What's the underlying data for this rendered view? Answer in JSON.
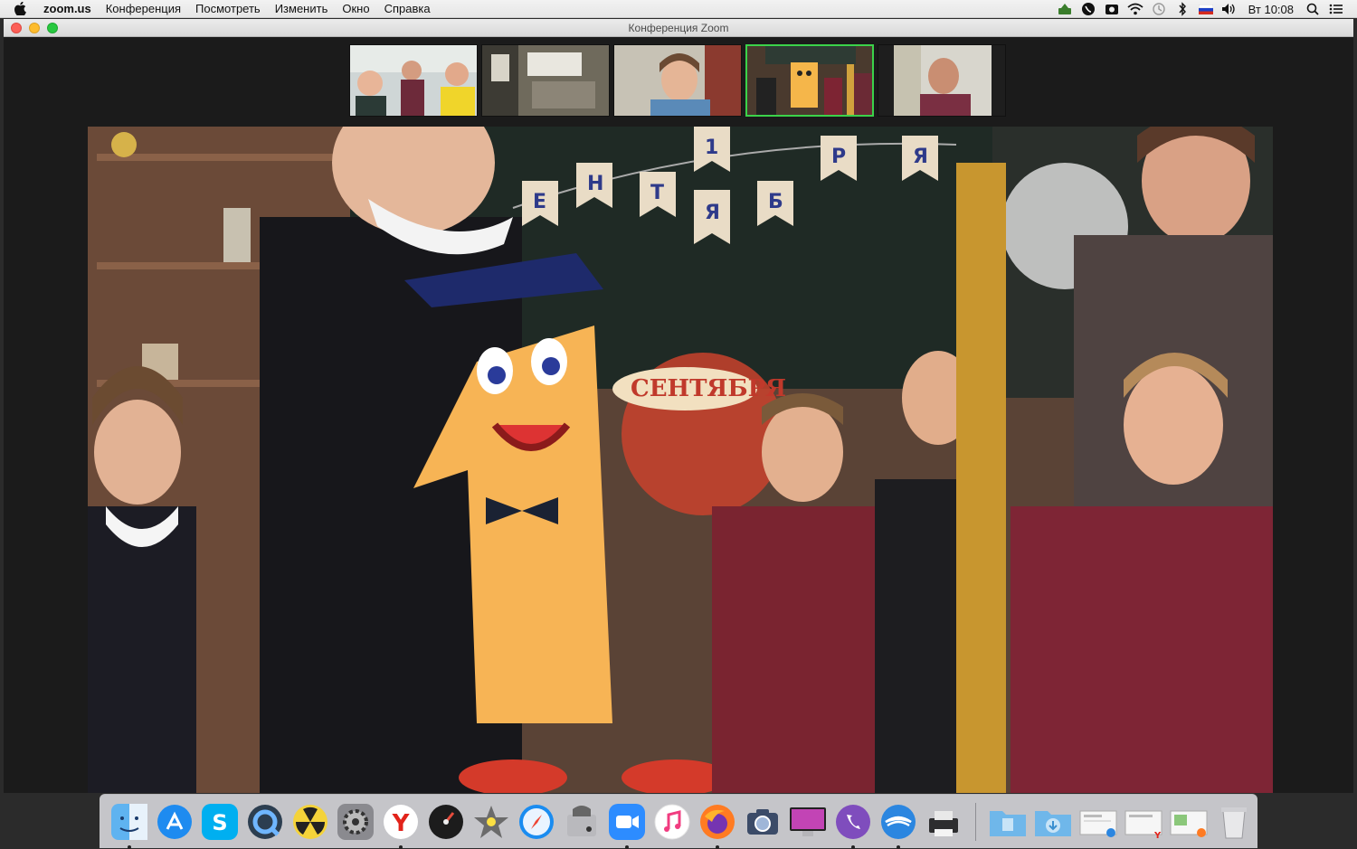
{
  "menubar": {
    "app_name": "zoom.us",
    "items": [
      "Конференция",
      "Посмотреть",
      "Изменить",
      "Окно",
      "Справка"
    ],
    "clock": "Вт 10:08",
    "status_icons": [
      "upload-icon",
      "viber-status-icon",
      "camera-status-icon",
      "wifi-icon",
      "time-machine-icon",
      "bluetooth-icon",
      "russian-flag-icon",
      "volume-icon",
      "clock-text",
      "spotlight-icon",
      "notification-center-icon"
    ]
  },
  "window": {
    "title": "Конференция Zoom"
  },
  "thumbnails": [
    {
      "id": "participant-1",
      "active": false
    },
    {
      "id": "participant-2",
      "active": false
    },
    {
      "id": "participant-3",
      "active": false
    },
    {
      "id": "participant-4",
      "active": true
    },
    {
      "id": "participant-5",
      "active": false
    }
  ],
  "main_video": {
    "banner_letters": [
      "Е",
      "Н",
      "Т",
      "Я",
      "1",
      "Б",
      "Р",
      "Я"
    ],
    "sign_text": "СЕНТЯБРЯ"
  },
  "dock": {
    "apps": [
      {
        "name": "finder",
        "running": true
      },
      {
        "name": "app-store",
        "running": false
      },
      {
        "name": "skype",
        "running": false
      },
      {
        "name": "quicktime",
        "running": false
      },
      {
        "name": "radiation",
        "running": false
      },
      {
        "name": "system-preferences",
        "running": false
      },
      {
        "name": "yandex-browser",
        "running": true
      },
      {
        "name": "dashboard",
        "running": false
      },
      {
        "name": "imovie",
        "running": false
      },
      {
        "name": "safari",
        "running": false
      },
      {
        "name": "disk-utility",
        "running": false
      },
      {
        "name": "zoom",
        "running": true
      },
      {
        "name": "itunes",
        "running": false
      },
      {
        "name": "firefox",
        "running": true
      },
      {
        "name": "image-capture",
        "running": false
      },
      {
        "name": "imac",
        "running": false
      },
      {
        "name": "viber",
        "running": true
      },
      {
        "name": "mail",
        "running": true
      },
      {
        "name": "printer",
        "running": false
      }
    ],
    "right_items": [
      "applications-folder",
      "downloads-folder",
      "document-stack-1",
      "document-stack-2",
      "document-stack-3",
      "trash"
    ]
  }
}
